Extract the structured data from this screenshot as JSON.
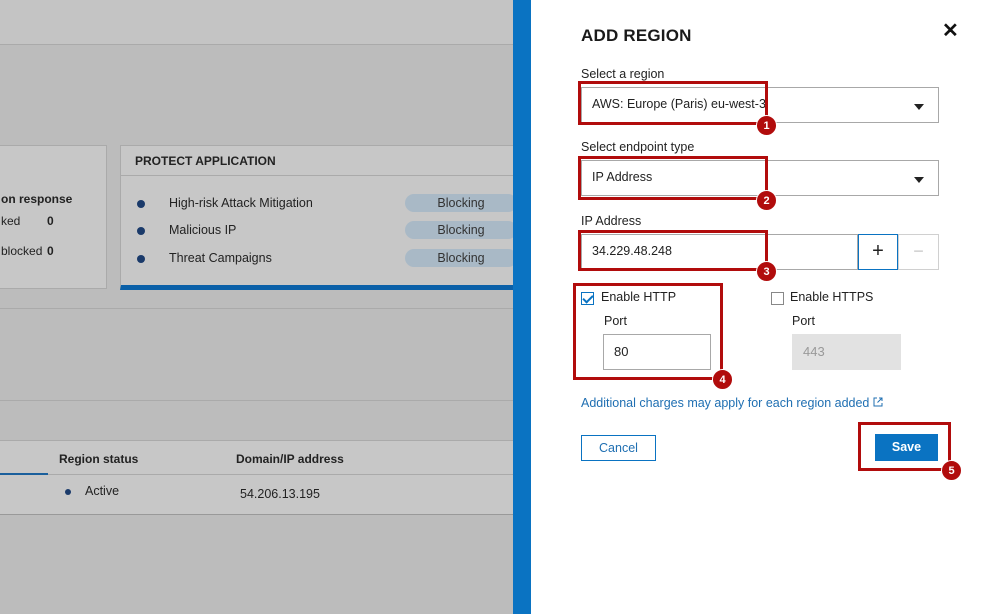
{
  "background": {
    "left_card": {
      "heading": "on response",
      "rows": [
        {
          "label": "ked",
          "value": "0"
        },
        {
          "label": "blocked",
          "value": "0"
        }
      ]
    },
    "protect_card": {
      "title": "PROTECT APPLICATION",
      "rows": [
        {
          "label": "High-risk Attack Mitigation",
          "status": "Blocking"
        },
        {
          "label": "Malicious IP",
          "status": "Blocking"
        },
        {
          "label": "Threat Campaigns",
          "status": "Blocking"
        }
      ]
    },
    "table": {
      "columns": [
        "Region status",
        "Domain/IP address"
      ],
      "rows": [
        {
          "status": "Active",
          "address": "54.206.13.195"
        }
      ]
    }
  },
  "panel": {
    "title": "ADD REGION",
    "close_icon": "close-icon",
    "region_label": "Select a region",
    "region_value": "AWS: Europe (Paris) eu-west-3",
    "endpoint_label": "Select endpoint type",
    "endpoint_value": "IP Address",
    "ip_label": "IP Address",
    "ip_value": "34.229.48.248",
    "plus_label": "+",
    "minus_label": "−",
    "http": {
      "label": "Enable HTTP",
      "checked": true,
      "port_label": "Port",
      "port_value": "80"
    },
    "https": {
      "label": "Enable HTTPS",
      "checked": false,
      "port_label": "Port",
      "port_value": "443"
    },
    "charges_link": "Additional charges may apply for each region added",
    "cancel_label": "Cancel",
    "save_label": "Save"
  },
  "callouts": [
    "1",
    "2",
    "3",
    "4",
    "5"
  ],
  "colors": {
    "accent": "#0a73c2",
    "callout": "#b10c0c",
    "link": "#1f6fb2",
    "protect_card_bar": "#0a60a8"
  }
}
